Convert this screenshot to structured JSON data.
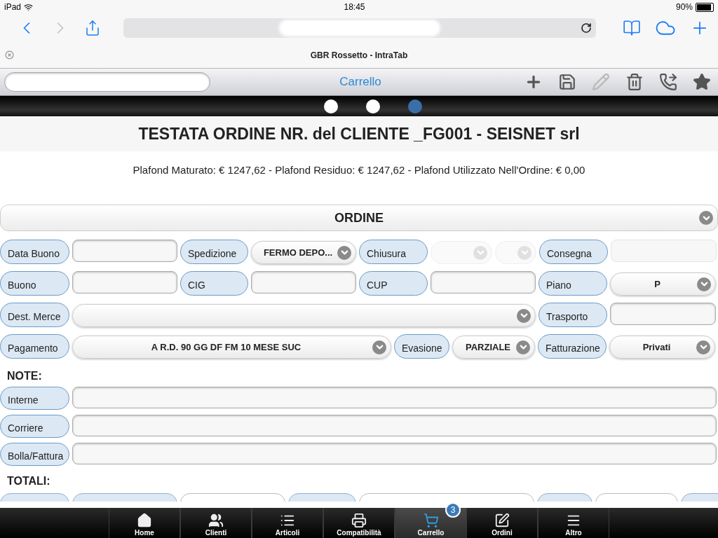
{
  "status_bar": {
    "device": "iPad",
    "time": "18:45",
    "battery": "90%"
  },
  "browser": {
    "back_disabled": false,
    "forward_disabled": true,
    "tab_title": "GBR Rossetto - IntraTab"
  },
  "app_bar": {
    "title": "Carrello",
    "actions": [
      {
        "kind": "add",
        "disabled": false
      },
      {
        "kind": "save",
        "disabled": false
      },
      {
        "kind": "edit",
        "disabled": true
      },
      {
        "kind": "delete",
        "disabled": false
      },
      {
        "kind": "call",
        "disabled": false
      },
      {
        "kind": "favorite",
        "disabled": false
      }
    ]
  },
  "pager": [
    {
      "selected": false
    },
    {
      "selected": false
    },
    {
      "selected": true
    }
  ],
  "heading": "TESTATA ORDINE NR. del CLIENTE _FG001 - SEISNET srl",
  "plafond": "Plafond Maturato: € 1247,62 - Plafond Residuo: € 1247,62 - Plafond Utilizzato Nell'Ordine: € 0,00",
  "section": {
    "title": "ORDINE"
  },
  "form_rows": [
    [
      {
        "kind": "label",
        "text": "Data Buono"
      },
      {
        "kind": "input",
        "disabled": false
      },
      {
        "kind": "label",
        "text": "Spedizione"
      },
      {
        "kind": "select",
        "value": "FERMO DEPO...",
        "disabled": false
      },
      {
        "kind": "label",
        "text": "Chiusura"
      },
      {
        "kind": "select",
        "disabled": true
      },
      {
        "kind": "select",
        "disabled": true
      },
      {
        "kind": "label",
        "text": "Consegna"
      },
      {
        "kind": "input",
        "disabled": true
      }
    ],
    [
      {
        "kind": "label",
        "text": "Buono"
      },
      {
        "kind": "input",
        "disabled": false
      },
      {
        "kind": "label",
        "text": "CIG"
      },
      {
        "kind": "input",
        "disabled": false
      },
      {
        "kind": "label",
        "text": "CUP"
      },
      {
        "kind": "input",
        "disabled": false
      },
      {
        "kind": "label",
        "text": "Piano"
      },
      {
        "kind": "select",
        "value": "P",
        "disabled": false
      }
    ],
    [
      {
        "kind": "label",
        "text": "Dest. Merce"
      },
      {
        "kind": "select",
        "disabled": false
      },
      {
        "kind": "label",
        "text": "Trasporto"
      },
      {
        "kind": "input",
        "disabled": false
      }
    ],
    [
      {
        "kind": "label",
        "text": "Pagamento"
      },
      {
        "kind": "select",
        "value": "A R.D. 90 GG DF FM 10 MESE SUC",
        "disabled": false
      },
      {
        "kind": "label",
        "text": "Evasione"
      },
      {
        "kind": "select",
        "value": "PARZIALE",
        "disabled": false
      },
      {
        "kind": "label",
        "text": "Fatturazione"
      },
      {
        "kind": "select",
        "value": "Privati",
        "disabled": false
      }
    ]
  ],
  "notes": {
    "title": "NOTE:",
    "rows": [
      {
        "label": "Interne"
      },
      {
        "label": "Corriere"
      },
      {
        "label": "Bolla/Fattura"
      }
    ]
  },
  "totals": {
    "title": "TOTALI:"
  },
  "tab_bar": [
    {
      "kind": "home",
      "label": "Home",
      "selected": false
    },
    {
      "kind": "clients",
      "label": "Clienti",
      "selected": false
    },
    {
      "kind": "articles",
      "label": "Articoli",
      "selected": false
    },
    {
      "kind": "compat",
      "label": "Compatibilità",
      "selected": false
    },
    {
      "kind": "cart",
      "label": "Carrello",
      "selected": true,
      "badge": "3"
    },
    {
      "kind": "orders",
      "label": "Ordini",
      "selected": false
    },
    {
      "kind": "more",
      "label": "Altro",
      "selected": false
    }
  ]
}
